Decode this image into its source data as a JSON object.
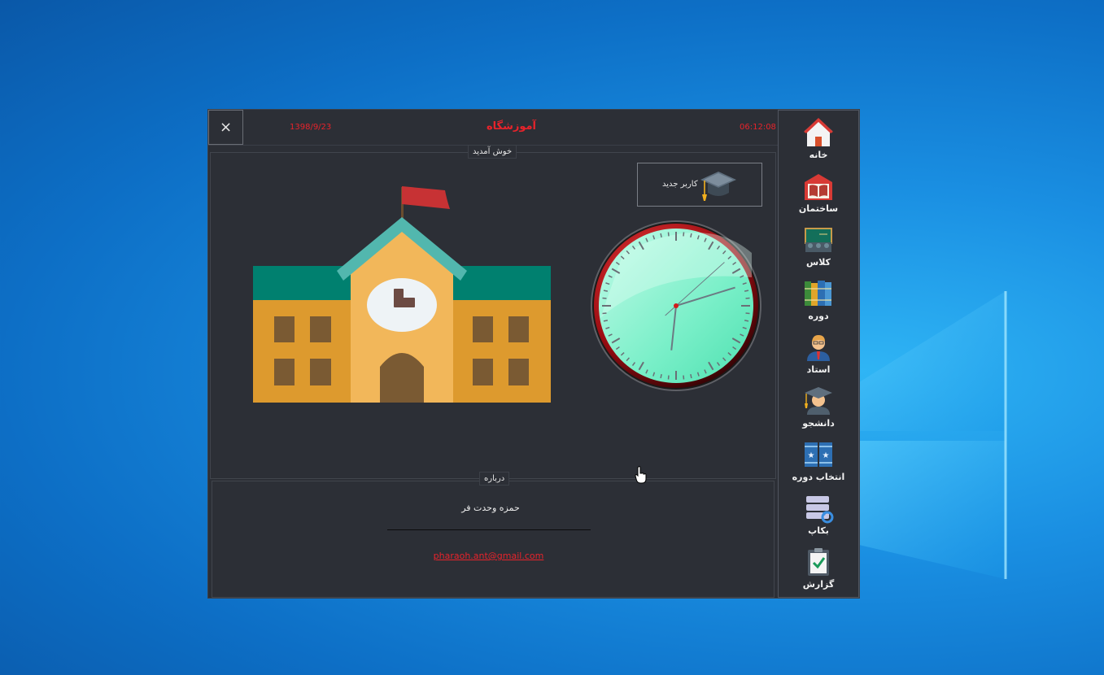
{
  "window": {
    "title": "آموزشگاه",
    "date": "1398/9/23",
    "time": "06:12:08",
    "close_icon": "×"
  },
  "welcome": {
    "legend": "خوش آمدید",
    "new_user_label": "کاربر جدید"
  },
  "about": {
    "legend": "درباره",
    "author": "حمزه وحدت فر",
    "email": "pharaoh.ant@gmail.com"
  },
  "clock": {
    "hours": 6,
    "minutes": 12,
    "seconds": 8
  },
  "sidebar": {
    "items": [
      {
        "label": "خانه",
        "icon": "home-icon"
      },
      {
        "label": "ساختمان",
        "icon": "building-icon"
      },
      {
        "label": "کلاس",
        "icon": "classroom-icon"
      },
      {
        "label": "دوره",
        "icon": "books-icon"
      },
      {
        "label": "استاد",
        "icon": "teacher-icon"
      },
      {
        "label": "دانشجو",
        "icon": "student-icon"
      },
      {
        "label": "انتخاب دوره",
        "icon": "course-select-icon"
      },
      {
        "label": "بکاپ",
        "icon": "backup-icon"
      },
      {
        "label": "گزارش",
        "icon": "report-icon"
      }
    ]
  },
  "colors": {
    "accent_red": "#e8232b",
    "panel_bg": "#2c2f36"
  }
}
